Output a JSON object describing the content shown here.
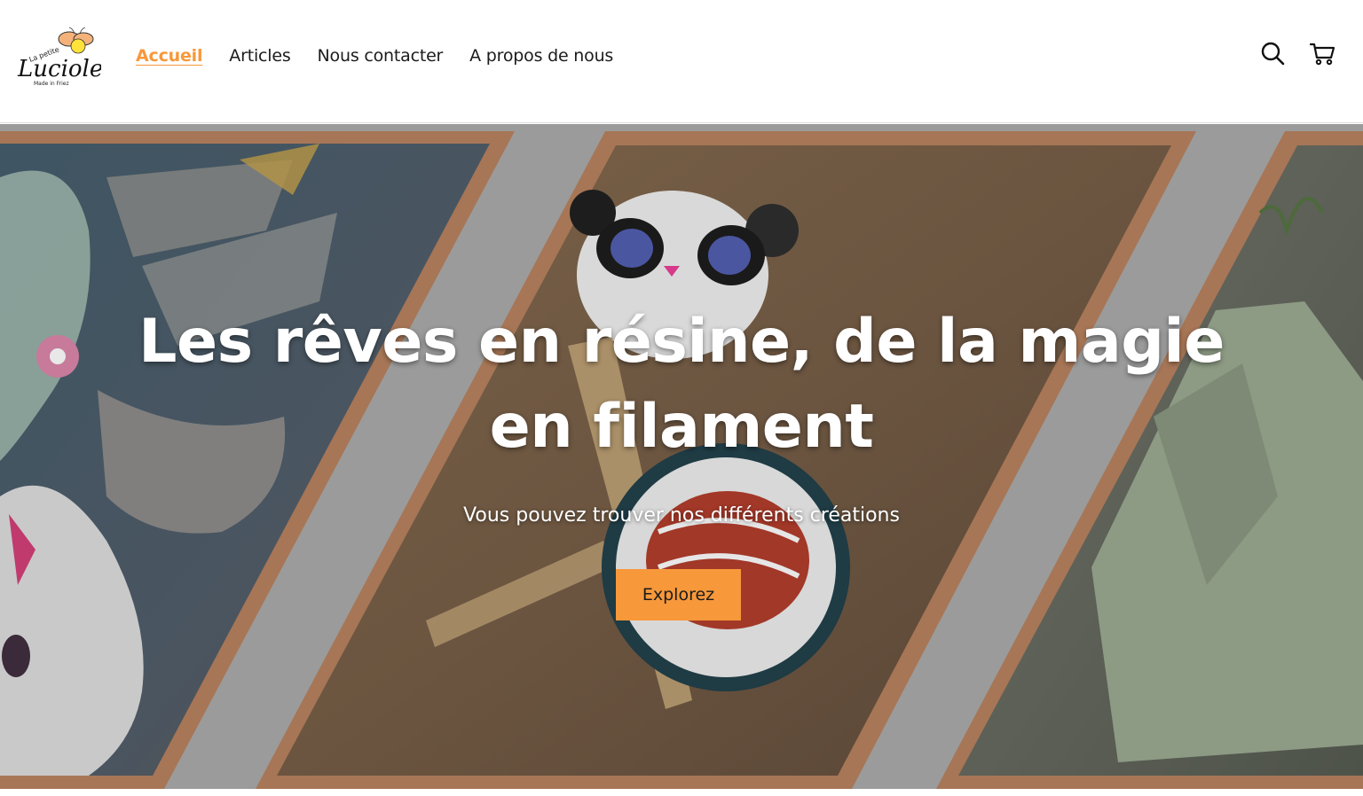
{
  "brand": {
    "logo_line1": "La petite",
    "logo_line2": "Luciole",
    "logo_line3": "Made in Friez"
  },
  "nav": {
    "items": [
      {
        "label": "Accueil",
        "active": true
      },
      {
        "label": "Articles",
        "active": false
      },
      {
        "label": "Nous contacter",
        "active": false
      },
      {
        "label": "A propos de nous",
        "active": false
      }
    ]
  },
  "header_icons": [
    "search-icon",
    "cart-icon"
  ],
  "hero": {
    "title": "Les rêves en résine, de la magie en filament",
    "subtitle": "Vous pouvez trouver nos différents créations",
    "cta_label": "Explorez"
  },
  "colors": {
    "accent": "#f7983a",
    "frame": "#b07a5a",
    "hero_gray": "#9a9a9a",
    "text": "#1b1b1b"
  }
}
